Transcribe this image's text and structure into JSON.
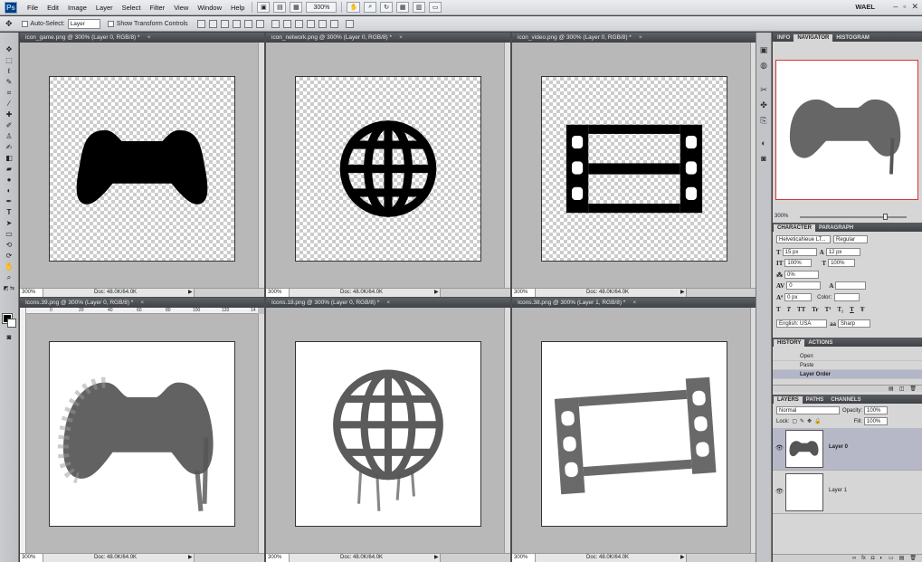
{
  "app": {
    "logo": "Ps",
    "user": "WAEL",
    "zoom_select": "300%",
    "window_controls": [
      "–",
      "▫",
      "✕"
    ]
  },
  "menubar": {
    "items": [
      "File",
      "Edit",
      "Image",
      "Layer",
      "Select",
      "Filter",
      "View",
      "Window",
      "Help"
    ]
  },
  "options_bar": {
    "auto_select_label": "Auto-Select:",
    "auto_select_value": "Layer",
    "transform_label": "Show Transform Controls"
  },
  "documents": [
    {
      "title": "icon_game.png @ 300% (Layer 0, RGB/8) *",
      "zoom": "300%",
      "doc_info": "Doc: 48.0K/64.0K",
      "icon": "gamepad-icon",
      "style": "solid"
    },
    {
      "title": "icon_network.png @ 300% (Layer 0, RGB/8) *",
      "zoom": "300%",
      "doc_info": "Doc: 48.0K/64.0K",
      "icon": "globe-icon",
      "style": "solid"
    },
    {
      "title": "icon_video.png @ 300% (Layer 0, RGB/8) *",
      "zoom": "300%",
      "doc_info": "Doc: 48.0K/64.0K",
      "icon": "film-icon",
      "style": "solid"
    },
    {
      "title": "Icons.39.png @ 300% (Layer 0, RGB/8) *",
      "zoom": "300%",
      "doc_info": "Doc: 48.0K/64.0K",
      "icon": "gamepad-icon",
      "style": "grunge"
    },
    {
      "title": "Icons.18.png @ 300% (Layer 0, RGB/8) *",
      "zoom": "300%",
      "doc_info": "Doc: 48.0K/64.0K",
      "icon": "globe-icon",
      "style": "grunge"
    },
    {
      "title": "Icons.38.png @ 300% (Layer 1, RGB/8) *",
      "zoom": "300%",
      "doc_info": "Doc: 48.0K/64.0K",
      "icon": "film-icon",
      "style": "grunge"
    }
  ],
  "ruler_ticks": [
    "0",
    "20",
    "40",
    "60",
    "80",
    "100",
    "120",
    "14"
  ],
  "navigator": {
    "tabs": [
      "INFO",
      "NAVIGATOR",
      "HISTOGRAM"
    ],
    "zoom": "300%"
  },
  "character": {
    "tabs": [
      "CHARACTER",
      "PARAGRAPH"
    ],
    "font_family": "HelveticaNeue LT...",
    "font_style": "Regular",
    "font_size": "15 px",
    "leading": "12 px",
    "vertical_scale": "100%",
    "horizontal_scale": "100%",
    "tracking": "0%",
    "kerning": "0",
    "baseline": "0 px",
    "color_label": "Color:",
    "language": "English: USA",
    "antialias": "Sharp",
    "style_buttons": [
      "T",
      "T",
      "TT",
      "Tr",
      "T¹",
      "T₁",
      "T",
      "Ŧ"
    ]
  },
  "history": {
    "tabs": [
      "HISTORY",
      "ACTIONS"
    ],
    "items": [
      "Open",
      "Paste",
      "Layer Order"
    ],
    "selected": 2
  },
  "layers": {
    "tabs": [
      "LAYERS",
      "PATHS",
      "CHANNELS"
    ],
    "blend_mode": "Normal",
    "opacity_label": "Opacity:",
    "opacity": "100%",
    "lock_label": "Lock:",
    "fill_label": "Fill:",
    "fill": "100%",
    "items": [
      {
        "name": "Layer 0",
        "selected": true
      },
      {
        "name": "Layer 1",
        "selected": false
      }
    ]
  }
}
